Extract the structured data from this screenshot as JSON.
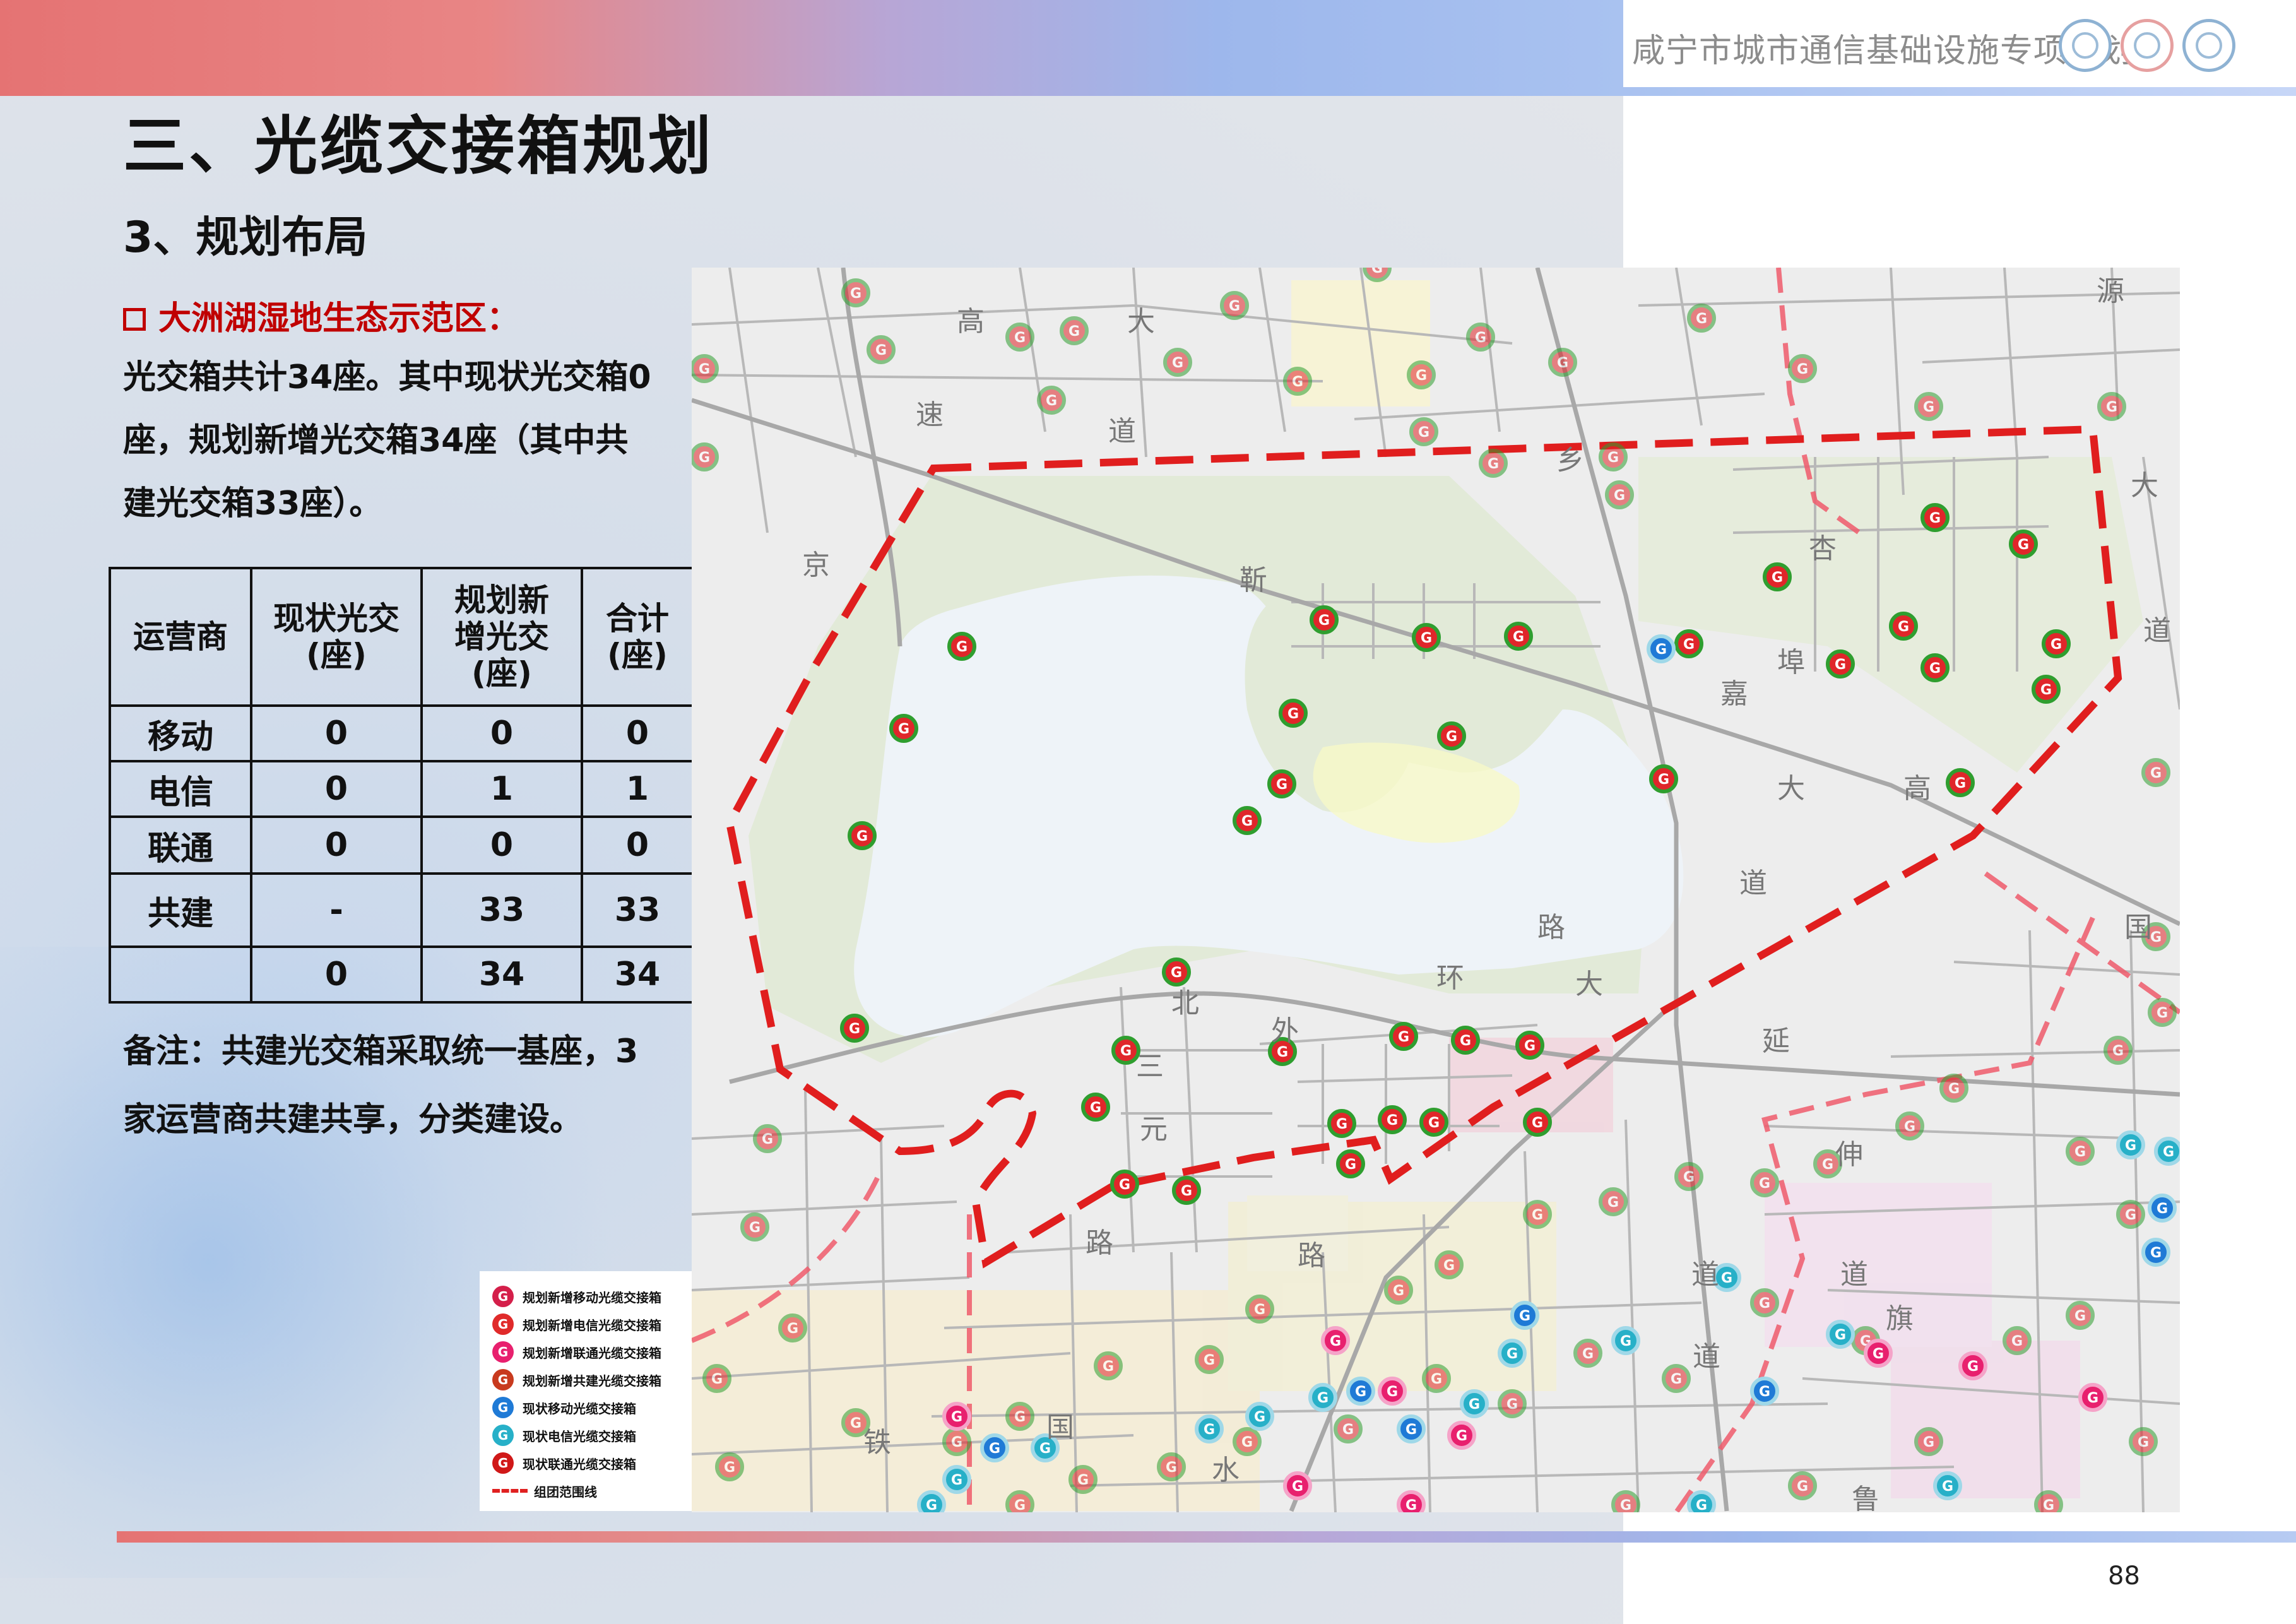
{
  "header": {
    "title": "咸宁市城市通信基础设施专项规划",
    "logos": [
      "china-mobile-logo",
      "china-unicom-logo",
      "china-telecom-logo"
    ]
  },
  "title": "三、光缆交接箱规划",
  "subtitle": "3、规划布局",
  "section": {
    "icon": "checkbox-square-icon",
    "heading": "大洲湖湿地生态示范区："
  },
  "paragraph_lines": [
    "光交箱共计34座。其中现状光交箱0",
    "座，规划新增光交箱34座（其中共",
    "建光交箱33座）。"
  ],
  "table": {
    "headers": {
      "operator": "运营商",
      "existing": [
        "现状光交",
        "(座)"
      ],
      "planned": [
        "规划新",
        "增光交",
        "(座)"
      ],
      "total": [
        "合计",
        "(座)"
      ]
    },
    "rows": [
      {
        "operator": "移动",
        "existing": "0",
        "planned": "0",
        "total": "0"
      },
      {
        "operator": "电信",
        "existing": "0",
        "planned": "1",
        "total": "1"
      },
      {
        "operator": "联通",
        "existing": "0",
        "planned": "0",
        "total": "0"
      },
      {
        "operator": "共建",
        "existing": "-",
        "planned": "33",
        "total": "33"
      },
      {
        "operator": "",
        "existing": "0",
        "planned": "34",
        "total": "34"
      }
    ]
  },
  "note_lines": [
    "备注：共建光交箱采取统一基座，3",
    "家运营商共建共享，分类建设。"
  ],
  "map": {
    "labels": [
      "高",
      "大",
      "速",
      "道",
      "京",
      "靳",
      "乡",
      "源",
      "大",
      "道",
      "杏",
      "嘉",
      "埠",
      "大",
      "高",
      "道",
      "路",
      "环",
      "大",
      "国",
      "北",
      "外",
      "三",
      "元",
      "路",
      "延",
      "伸",
      "道",
      "路",
      "道",
      "旗",
      "道",
      "铁",
      "国",
      "水",
      "鲁"
    ],
    "boundary_color": "#e01e1e",
    "marker_color": "#2f9e2f"
  },
  "legend": {
    "items": [
      {
        "label": "规划新增移动光缆交接箱",
        "color": "#d41f4a",
        "icon": "g-marker-icon"
      },
      {
        "label": "规划新增电信光缆交接箱",
        "color": "#e02a2a",
        "icon": "g-marker-icon"
      },
      {
        "label": "规划新增联通光缆交接箱",
        "color": "#e8206e",
        "icon": "g-marker-icon"
      },
      {
        "label": "规划新增共建光缆交接箱",
        "color": "#c83a1e",
        "icon": "g-marker-icon"
      },
      {
        "label": "现状移动光缆交接箱",
        "color": "#1f7ad6",
        "icon": "g-marker-icon"
      },
      {
        "label": "现状电信光缆交接箱",
        "color": "#27b0c8",
        "icon": "g-marker-icon"
      },
      {
        "label": "现状联通光缆交接箱",
        "color": "#d01818",
        "icon": "g-marker-icon"
      },
      {
        "label": "组团范围线",
        "color": "#e02020",
        "icon": "dashed-line-icon"
      }
    ]
  },
  "page_number": "88"
}
